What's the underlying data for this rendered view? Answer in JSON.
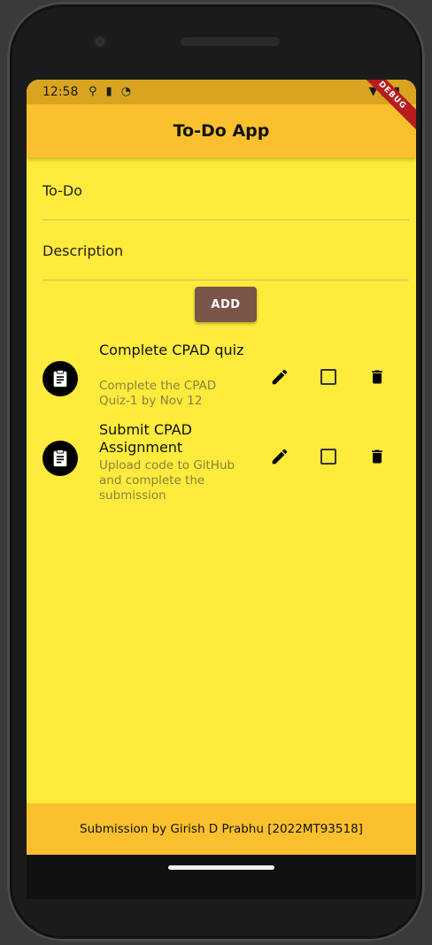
{
  "status_bar": {
    "time": "12:58",
    "left_icons": [
      "usb-icon",
      "sd-card-icon",
      "sync-icon"
    ],
    "right_icons": [
      "wifi-icon",
      "signal-icon",
      "battery-icon"
    ]
  },
  "app_bar": {
    "title": "To-Do App",
    "debug_label": "DEBUG",
    "color": "#FBC02D"
  },
  "form": {
    "todo_label": "To-Do",
    "description_label": "Description",
    "add_label": "ADD",
    "add_color": "#795548"
  },
  "todos": [
    {
      "title": "Complete CPAD quiz",
      "description": "Complete the CPAD Quiz-1 by Nov 12",
      "done": false
    },
    {
      "title": "Submit CPAD Assignment",
      "description": "Upload code to GitHub and complete the submission",
      "done": false
    }
  ],
  "footer": {
    "text": "Submission by Girish D Prabhu [2022MT93518]"
  },
  "colors": {
    "background": "#FEEB3B",
    "accent": "#FBC02D"
  }
}
